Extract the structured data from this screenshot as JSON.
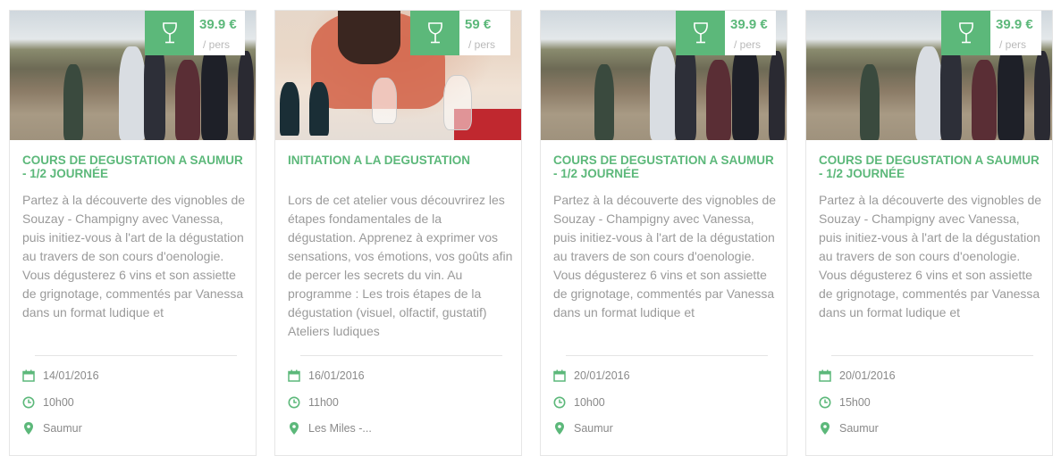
{
  "colors": {
    "accent": "#5cb87a",
    "text_muted": "#9a9a9a"
  },
  "cards": [
    {
      "image": "vineyard-group-photo",
      "price": "39.9 €",
      "price_unit": "/ pers",
      "title": "COURS DE DEGUSTATION A SAUMUR - 1/2 JOURNÉE",
      "description": "Partez à la découverte des vignobles de Souzay - Champigny avec Vanessa, puis initiez-vous à l'art de la dégustation au travers de son cours d'oenologie. Vous dégusterez 6 vins et son assiette de grignotage, commentés par Vanessa dans un format ludique et",
      "date": "14/01/2016",
      "time": "10h00",
      "place": "Saumur"
    },
    {
      "image": "wine-glasses-tasting-photo",
      "price": "59 €",
      "price_unit": "/ pers",
      "title": "INITIATION A LA DEGUSTATION",
      "description": "Lors de cet atelier vous découvrirez les étapes fondamentales de la dégustation. Apprenez à exprimer vos sensations, vos émotions, vos goûts afin de percer les secrets du vin.   Au programme :   Les trois étapes de la dégustation (visuel, olfactif, gustatif) Ateliers ludiques",
      "date": "16/01/2016",
      "time": "11h00",
      "place": "Les Miles -..."
    },
    {
      "image": "vineyard-group-photo",
      "price": "39.9 €",
      "price_unit": "/ pers",
      "title": "COURS DE DEGUSTATION A SAUMUR - 1/2 JOURNÉE",
      "description": "Partez à la découverte des vignobles de Souzay - Champigny avec Vanessa, puis initiez-vous à l'art de la dégustation au travers de son cours d'oenologie. Vous dégusterez 6 vins et son assiette de grignotage, commentés par Vanessa dans un format ludique et",
      "date": "20/01/2016",
      "time": "10h00",
      "place": "Saumur"
    },
    {
      "image": "vineyard-group-photo",
      "price": "39.9 €",
      "price_unit": "/ pers",
      "title": "COURS DE DEGUSTATION A SAUMUR - 1/2 JOURNÉE",
      "description": "Partez à la découverte des vignobles de Souzay - Champigny avec Vanessa, puis initiez-vous à l'art de la dégustation au travers de son cours d'oenologie. Vous dégusterez 6 vins et son assiette de grignotage, commentés par Vanessa dans un format ludique et",
      "date": "20/01/2016",
      "time": "15h00",
      "place": "Saumur"
    }
  ]
}
